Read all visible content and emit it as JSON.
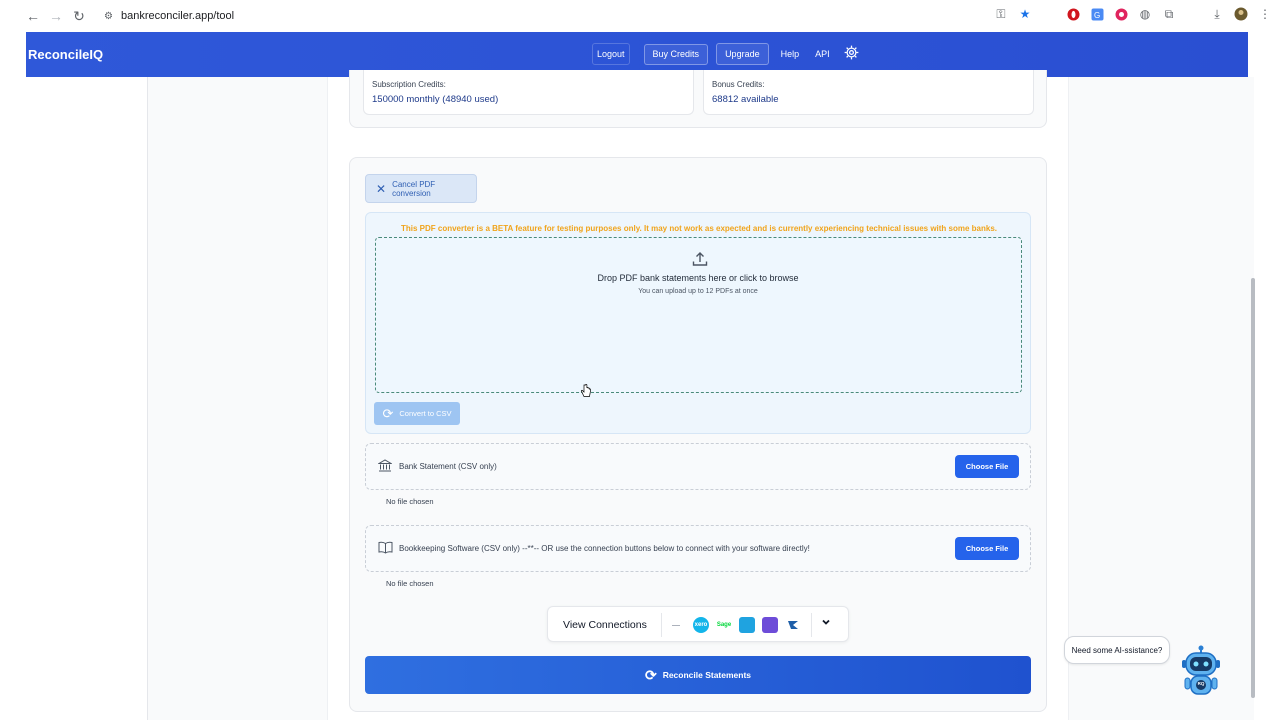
{
  "browser": {
    "url": "bankreconciler.app/tool",
    "icons": [
      "back-icon",
      "forward-icon",
      "reload-icon",
      "site-settings-icon",
      "password-key-icon",
      "bookmark-star-icon",
      "opera-extension-icon",
      "translate-extension-icon",
      "red-extension-icon",
      "globe-extension-icon",
      "puzzle-extension-icon",
      "download-icon",
      "profile-avatar",
      "kebab-menu-icon"
    ]
  },
  "header": {
    "brand": "ReconcileIQ",
    "nav": {
      "logout": "Logout",
      "buy_credits": "Buy Credits",
      "upgrade": "Upgrade",
      "help": "Help",
      "api": "API"
    }
  },
  "credits": {
    "subscription_label": "Subscription Credits:",
    "subscription_value": "150000 monthly (48940 used)",
    "bonus_label": "Bonus Credits:",
    "bonus_value": "68812 available"
  },
  "converter": {
    "cancel_label": "Cancel PDF conversion",
    "beta_note": "This PDF converter is a BETA feature for testing purposes only. It may not work as expected and is currently experiencing technical issues with some banks.",
    "drop_title": "Drop PDF bank statements here or click to browse",
    "drop_sub": "You can upload up to 12 PDFs at once",
    "convert_label": "Convert to CSV"
  },
  "uploads": {
    "bank": {
      "label": "Bank Statement (CSV only)",
      "button": "Choose File",
      "status": "No file chosen"
    },
    "bookkeeping": {
      "label": "Bookkeeping Software (CSV only) --**-- OR use the connection buttons below to connect with your software directly!",
      "button": "Choose File",
      "status": "No file chosen"
    }
  },
  "connections": {
    "label": "View Connections",
    "logos": {
      "l1": "—",
      "l2": "xero",
      "l3": "Sage",
      "l4": "",
      "l5": "",
      "l6": ""
    }
  },
  "reconcile": {
    "label": "Reconcile Statements"
  },
  "assistant": {
    "bubble": "Need some AI-ssistance?",
    "badge": "RQ"
  },
  "colors": {
    "header_blue": "#2f58d9",
    "primary_button": "#2563eb",
    "beta_warning": "#f0a41c",
    "credit_value": "#1e3a8a"
  }
}
